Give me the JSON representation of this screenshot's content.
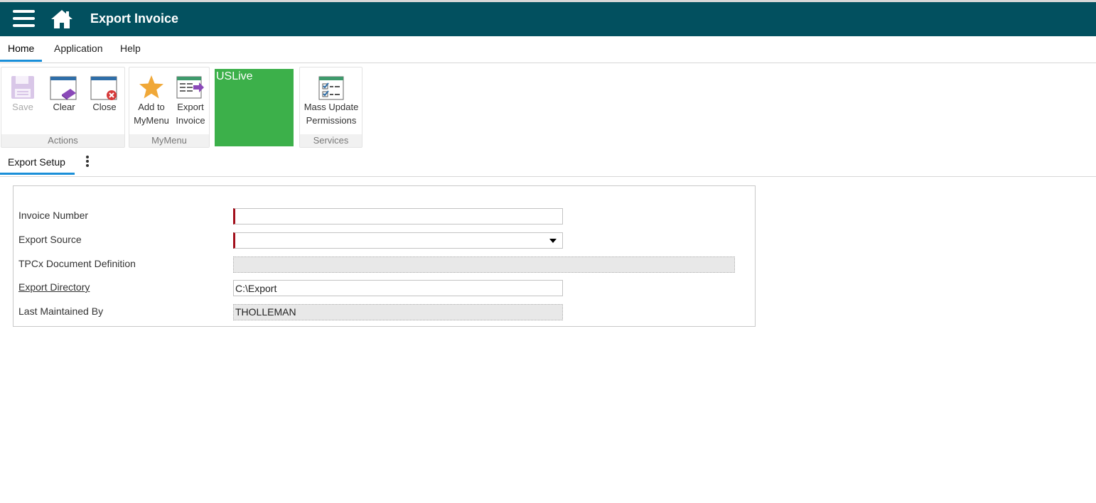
{
  "app": {
    "title": "Export Invoice",
    "colors": {
      "header": "#02505f",
      "accent": "#1a8fd8",
      "environment": "#3cb04a",
      "required": "#a3101c"
    }
  },
  "menu": {
    "tabs": [
      {
        "label": "Home",
        "active": true
      },
      {
        "label": "Application",
        "active": false
      },
      {
        "label": "Help",
        "active": false
      }
    ]
  },
  "ribbon": {
    "actions": {
      "label": "Actions",
      "save": {
        "label": "Save",
        "icon": "floppy-disk-icon",
        "enabled": false
      },
      "clear": {
        "label": "Clear",
        "icon": "eraser-icon"
      },
      "close": {
        "label": "Close",
        "icon": "close-window-icon"
      }
    },
    "mymenu": {
      "label": "MyMenu",
      "add": {
        "line1": "Add to",
        "line2": "MyMenu",
        "icon": "star-icon"
      },
      "export": {
        "line1": "Export",
        "line2": "Invoice",
        "icon": "export-document-icon"
      }
    },
    "environment": {
      "label": "USLive"
    },
    "services": {
      "label": "Services",
      "mass_update": {
        "line1": "Mass Update",
        "line2": "Permissions",
        "icon": "checklist-icon"
      }
    }
  },
  "subtabs": {
    "tabs": [
      {
        "label": "Export Setup",
        "active": true
      }
    ]
  },
  "form": {
    "invoice_number": {
      "label": "Invoice Number",
      "value": "",
      "required": true
    },
    "export_source": {
      "label": "Export Source",
      "value": "",
      "required": true
    },
    "tpcx_definition": {
      "label": "TPCx Document Definition",
      "value": "",
      "readonly": true
    },
    "export_directory": {
      "label": "Export Directory",
      "value": "C:\\Export"
    },
    "last_maintained_by": {
      "label": "Last Maintained By",
      "value": "THOLLEMAN",
      "readonly": true
    }
  }
}
